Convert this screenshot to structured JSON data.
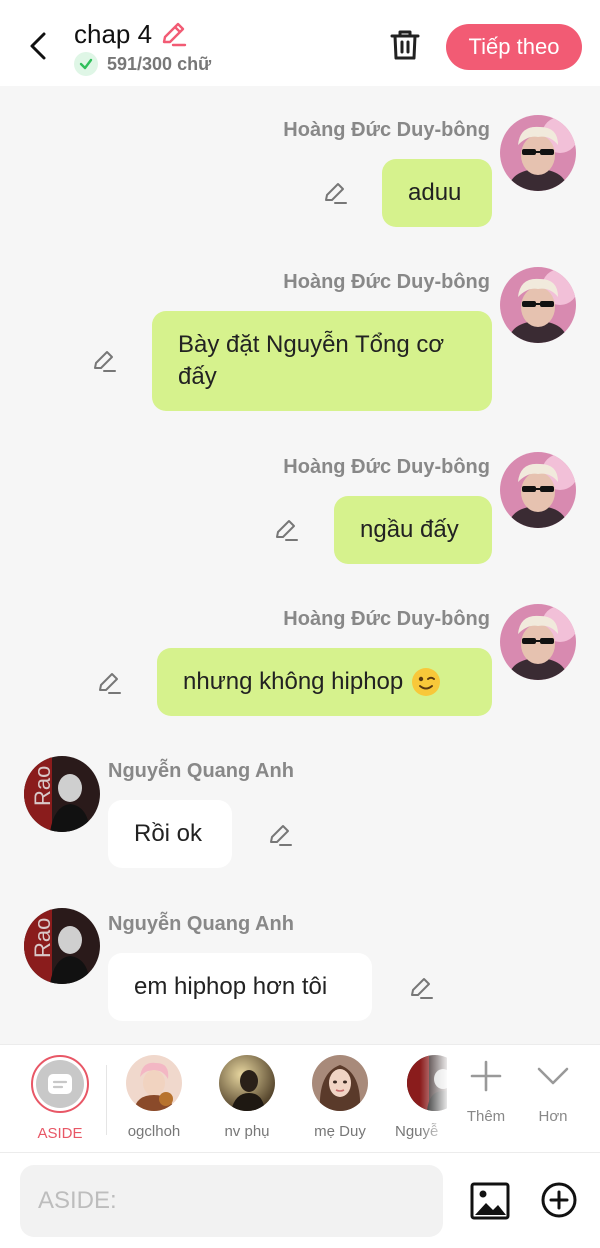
{
  "header": {
    "title": "chap 4",
    "word_count": "591/300 chữ",
    "next_label": "Tiếp theo"
  },
  "messages": [
    {
      "sender": "Hoàng Đức Duy-bông",
      "text": "aduu",
      "side": "right"
    },
    {
      "sender": "Hoàng Đức Duy-bông",
      "text": "Bày đặt Nguyễn Tổng cơ đấy",
      "side": "right"
    },
    {
      "sender": "Hoàng Đức Duy-bông",
      "text": "ngầu đấy",
      "side": "right"
    },
    {
      "sender": "Hoàng Đức Duy-bông",
      "text": "nhưng không hiphop",
      "emoji": "wink-emoji",
      "side": "right"
    },
    {
      "sender": "Nguyễn Quang Anh",
      "text": "Rồi ok",
      "side": "left"
    },
    {
      "sender": "Nguyễn Quang Anh",
      "text": "em hiphop hơn tôi",
      "side": "left"
    }
  ],
  "characters": [
    {
      "name": "ASIDE",
      "selected": true
    },
    {
      "name": "ogclhoh"
    },
    {
      "name": "nv phụ"
    },
    {
      "name": "mẹ Duy"
    },
    {
      "name": "Nguyễ"
    }
  ],
  "tools": {
    "add_label": "Thêm",
    "more_label": "Hơn"
  },
  "composer": {
    "placeholder": "ASIDE:"
  },
  "colors": {
    "accent": "#f25b74",
    "bubble_green": "#d6f28d",
    "aside_ring": "#e85766"
  }
}
